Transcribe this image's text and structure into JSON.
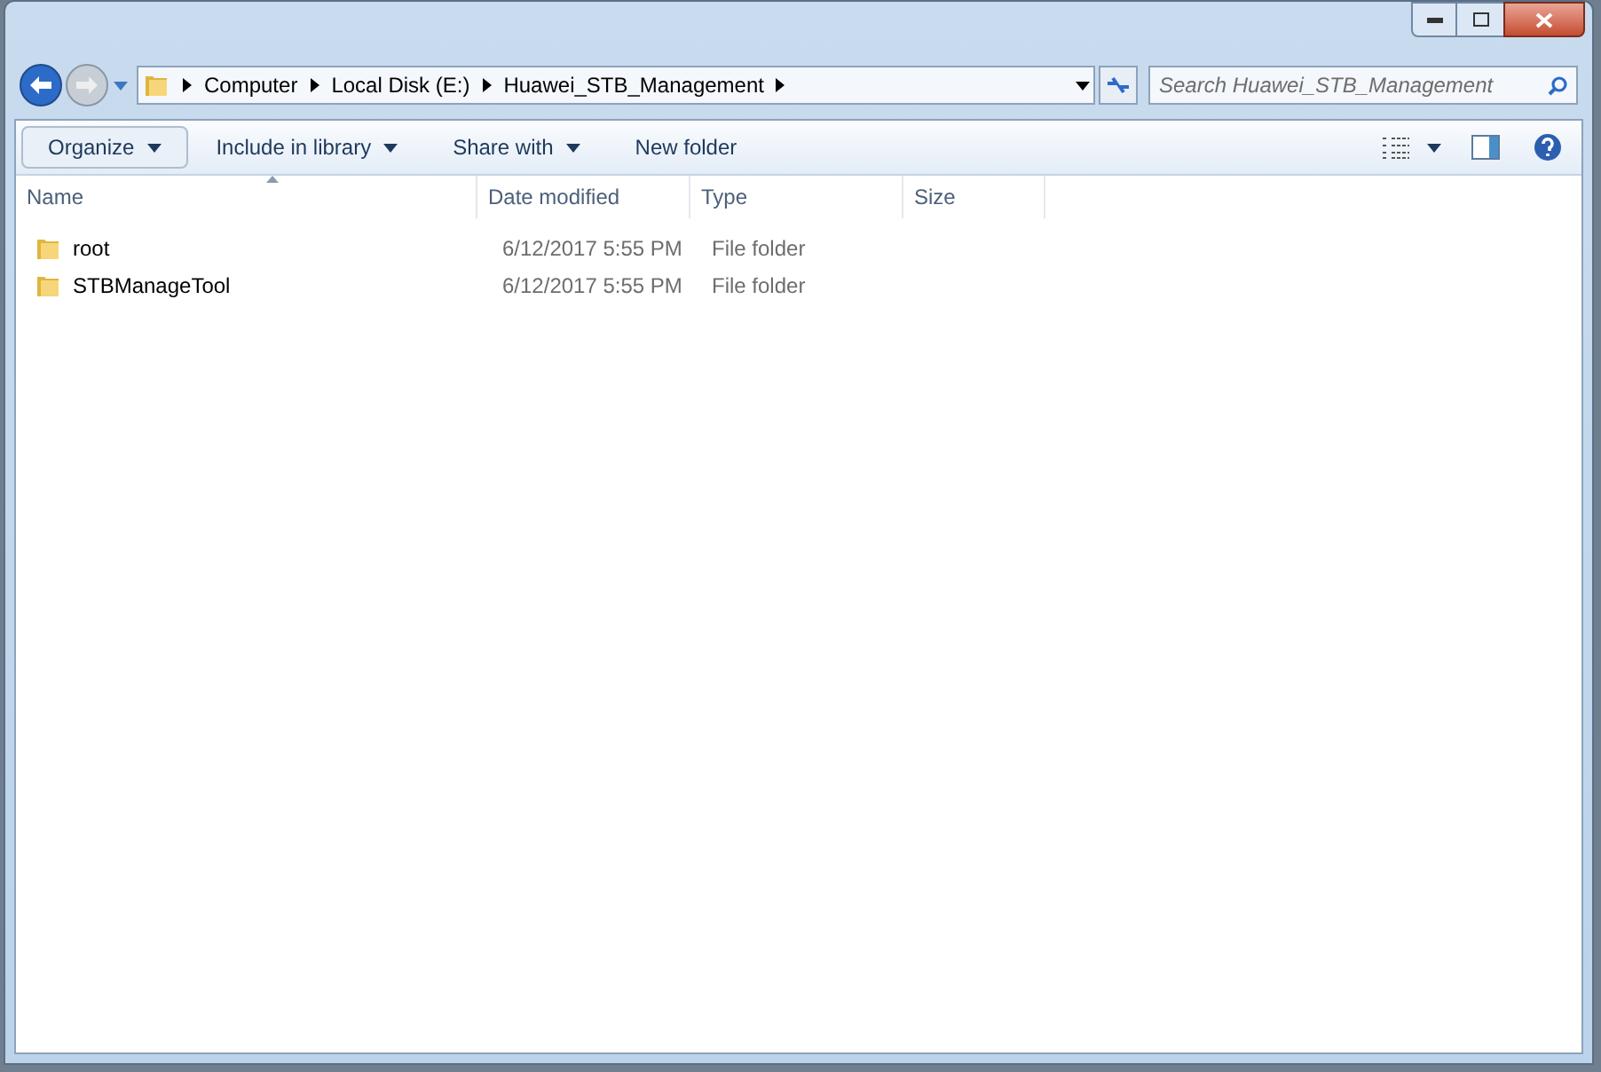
{
  "address_bar": {
    "segments": [
      "Computer",
      "Local Disk (E:)",
      "Huawei_STB_Management"
    ]
  },
  "search": {
    "placeholder": "Search Huawei_STB_Management"
  },
  "toolbar": {
    "buttons": [
      {
        "label": "Organize",
        "dropdown": true,
        "selected": true
      },
      {
        "label": "Include in library",
        "dropdown": true,
        "selected": false
      },
      {
        "label": "Share with",
        "dropdown": true,
        "selected": false
      },
      {
        "label": "New folder",
        "dropdown": false,
        "selected": false
      }
    ]
  },
  "table": {
    "columns": [
      "Name",
      "Date modified",
      "Type",
      "Size"
    ],
    "rows": [
      {
        "name": "root",
        "date_modified": "6/12/2017 5:55 PM",
        "type": "File folder"
      },
      {
        "name": "STBManageTool",
        "date_modified": "6/12/2017 5:55 PM",
        "type": "File folder"
      }
    ]
  }
}
